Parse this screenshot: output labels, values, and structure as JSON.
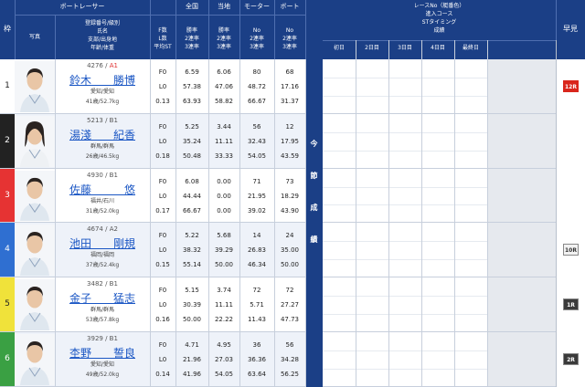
{
  "header": {
    "waku": "枠",
    "boat_racer": "ボートレーサー",
    "photo": "写真",
    "racer_info": [
      "登録番号/級別",
      "氏名",
      "支部/出身地",
      "年齢/体重"
    ],
    "f_l_st": [
      "F数",
      "L数",
      "平均ST"
    ],
    "zenkoku": "全国",
    "touchi": "当地",
    "motor": "モーター",
    "boat": "ボート",
    "rate_labels": [
      "勝率",
      "2連率",
      "3連率"
    ],
    "no_labels": [
      "No",
      "2連率",
      "3連率"
    ],
    "race_info": [
      "レースNo（艇番色）",
      "進入コース",
      "STタイミング",
      "成績"
    ],
    "days": [
      "初日",
      "2日目",
      "3日目",
      "4日目",
      "最終日"
    ],
    "hayami": "早見",
    "konsetsu": [
      "今",
      "節",
      "成",
      "績"
    ]
  },
  "colors": {
    "header_bg": "#1b3f86",
    "waku": [
      "#ffffff",
      "#222222",
      "#e63333",
      "#2f6fd1",
      "#f0e23a",
      "#3aa043"
    ],
    "waku_text": [
      "#222222",
      "#ffffff",
      "#ffffff",
      "#ffffff",
      "#222222",
      "#ffffff"
    ],
    "name_link": "#1a56c4",
    "grade_a1": "#e03030"
  },
  "racers": [
    {
      "lane": "1",
      "id_grade": "4276 / ",
      "grade": "A1",
      "name": "鈴木　　勝博",
      "branch": "愛知/愛知",
      "age_weight": "41歳/52.7kg",
      "f": "F0",
      "l": "L0",
      "st": "0.13",
      "zen": [
        "6.59",
        "57.38",
        "63.93"
      ],
      "tou": [
        "6.06",
        "47.06",
        "58.82"
      ],
      "mot": [
        "80",
        "48.72",
        "66.67"
      ],
      "boat": [
        "68",
        "17.16",
        "31.37"
      ],
      "hayami": "12R",
      "hayami_style": "red"
    },
    {
      "lane": "2",
      "id_grade": "5213 / ",
      "grade": "B1",
      "name": "湯淺　　紀香",
      "branch": "群馬/群馬",
      "age_weight": "26歳/46.5kg",
      "f": "F0",
      "l": "L0",
      "st": "0.18",
      "zen": [
        "5.25",
        "35.24",
        "50.48"
      ],
      "tou": [
        "3.44",
        "11.11",
        "33.33"
      ],
      "mot": [
        "56",
        "32.43",
        "54.05"
      ],
      "boat": [
        "12",
        "17.95",
        "43.59"
      ],
      "hayami": "",
      "hayami_style": ""
    },
    {
      "lane": "3",
      "id_grade": "4930 / ",
      "grade": "B1",
      "name": "佐藤　　　悠",
      "branch": "福井/石川",
      "age_weight": "31歳/52.0kg",
      "f": "F0",
      "l": "L0",
      "st": "0.17",
      "zen": [
        "6.08",
        "44.44",
        "66.67"
      ],
      "tou": [
        "0.00",
        "0.00",
        "0.00"
      ],
      "mot": [
        "71",
        "21.95",
        "39.02"
      ],
      "boat": [
        "73",
        "18.29",
        "43.90"
      ],
      "hayami": "",
      "hayami_style": ""
    },
    {
      "lane": "4",
      "id_grade": "4674 / ",
      "grade": "A2",
      "name": "池田　　剛規",
      "branch": "福岡/福岡",
      "age_weight": "37歳/52.4kg",
      "f": "F0",
      "l": "L0",
      "st": "0.15",
      "zen": [
        "5.22",
        "38.32",
        "55.14"
      ],
      "tou": [
        "5.68",
        "39.29",
        "50.00"
      ],
      "mot": [
        "14",
        "26.83",
        "46.34"
      ],
      "boat": [
        "24",
        "35.00",
        "50.00"
      ],
      "hayami": "10R",
      "hayami_style": "light"
    },
    {
      "lane": "5",
      "id_grade": "3482 / ",
      "grade": "B1",
      "name": "金子　　猛志",
      "branch": "群馬/群馬",
      "age_weight": "53歳/57.8kg",
      "f": "F0",
      "l": "L0",
      "st": "0.16",
      "zen": [
        "5.15",
        "30.39",
        "50.00"
      ],
      "tou": [
        "3.74",
        "11.11",
        "22.22"
      ],
      "mot": [
        "72",
        "5.71",
        "11.43"
      ],
      "boat": [
        "72",
        "27.27",
        "47.73"
      ],
      "hayami": "1R",
      "hayami_style": "dark"
    },
    {
      "lane": "6",
      "id_grade": "3929 / ",
      "grade": "B1",
      "name": "杢野　　誓良",
      "branch": "愛知/愛知",
      "age_weight": "49歳/52.0kg",
      "f": "F0",
      "l": "L0",
      "st": "0.14",
      "zen": [
        "4.71",
        "21.96",
        "41.96"
      ],
      "tou": [
        "4.95",
        "27.03",
        "54.05"
      ],
      "mot": [
        "36",
        "36.36",
        "63.64"
      ],
      "boat": [
        "56",
        "34.28",
        "56.25"
      ],
      "hayami": "2R",
      "hayami_style": "dark"
    }
  ]
}
